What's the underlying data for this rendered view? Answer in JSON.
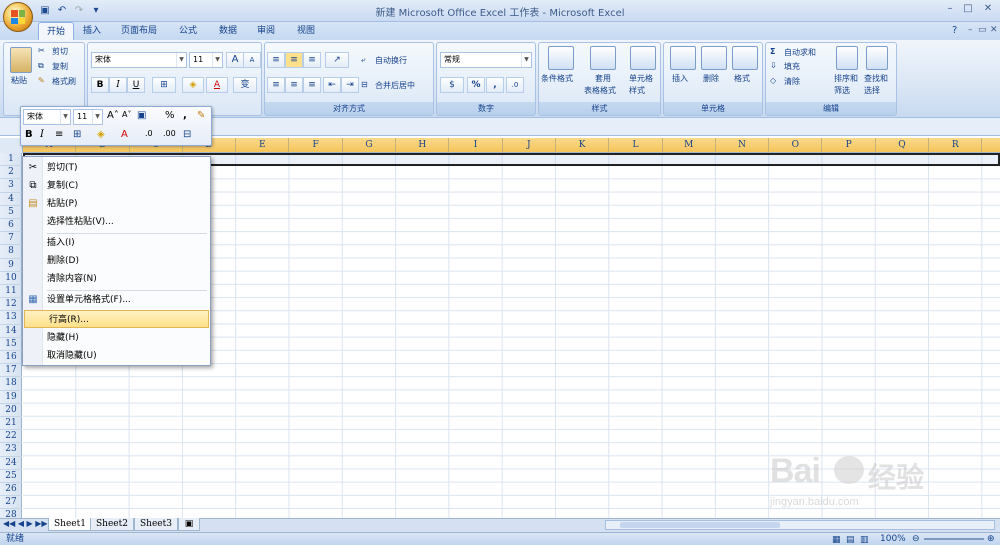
{
  "window": {
    "title": "新建 Microsoft Office Excel 工作表 - Microsoft Excel",
    "min": "–",
    "max": "□",
    "close": "✕",
    "ribbon_min": "–",
    "ribbon_restore": "▭",
    "ribbon_close": "✕"
  },
  "tabs": [
    "开始",
    "插入",
    "页面布局",
    "公式",
    "数据",
    "审阅",
    "视图"
  ],
  "clipboard": {
    "paste": "粘贴",
    "cut": "剪切",
    "copy": "复制",
    "painter": "格式刷"
  },
  "font": {
    "name": "宋体",
    "size": "11",
    "bold": "B",
    "italic": "I",
    "underline": "U",
    "grow": "A",
    "shrink": "A",
    "fontcolor": "A",
    "phonetic": "变"
  },
  "align": {
    "wrap": "自动换行",
    "merge": "合并后居中",
    "label": "对齐方式"
  },
  "number": {
    "format": "常规",
    "percent": "%",
    "comma": ",",
    "label": "数字"
  },
  "styles": {
    "cond": "条件格式",
    "table1": "套用",
    "table2": "表格格式",
    "cell1": "单元格",
    "cell2": "样式",
    "label": "样式"
  },
  "cells": {
    "insert": "插入",
    "delete": "删除",
    "format": "格式",
    "label": "单元格"
  },
  "editing": {
    "sum": "自动求和",
    "fill": "填充",
    "clear": "清除",
    "sort1": "排序和",
    "sort2": "筛选",
    "find1": "查找和",
    "find2": "选择",
    "label": "编辑"
  },
  "minitoolbar": {
    "font": "宋体",
    "size": "11",
    "bold": "B",
    "italic": "I",
    "percent": "%",
    "comma": ","
  },
  "columns": [
    "A",
    "B",
    "C",
    "D",
    "E",
    "F",
    "G",
    "H",
    "I",
    "J",
    "K",
    "L",
    "M",
    "N",
    "O",
    "P",
    "Q",
    "R"
  ],
  "rows": [
    "1",
    "2",
    "3",
    "4",
    "5",
    "6",
    "7",
    "8",
    "9",
    "10",
    "11",
    "12",
    "13",
    "14",
    "15",
    "16",
    "17",
    "18",
    "19",
    "20",
    "21",
    "22",
    "23",
    "24",
    "25",
    "26",
    "27",
    "28"
  ],
  "context_menu": {
    "cut": "剪切(T)",
    "copy": "复制(C)",
    "paste": "粘贴(P)",
    "paste_special": "选择性粘贴(V)...",
    "insert": "插入(I)",
    "delete": "删除(D)",
    "clear": "清除内容(N)",
    "format_cells": "设置单元格格式(F)...",
    "row_height": "行高(R)...",
    "hide": "隐藏(H)",
    "unhide": "取消隐藏(U)"
  },
  "sheets": [
    "Sheet1",
    "Sheet2",
    "Sheet3"
  ],
  "status": {
    "ready": "就绪",
    "zoom": "100%"
  },
  "watermark": {
    "brand": "Bai",
    "brand2": "经验",
    "url": "jingyan.baidu.com"
  }
}
